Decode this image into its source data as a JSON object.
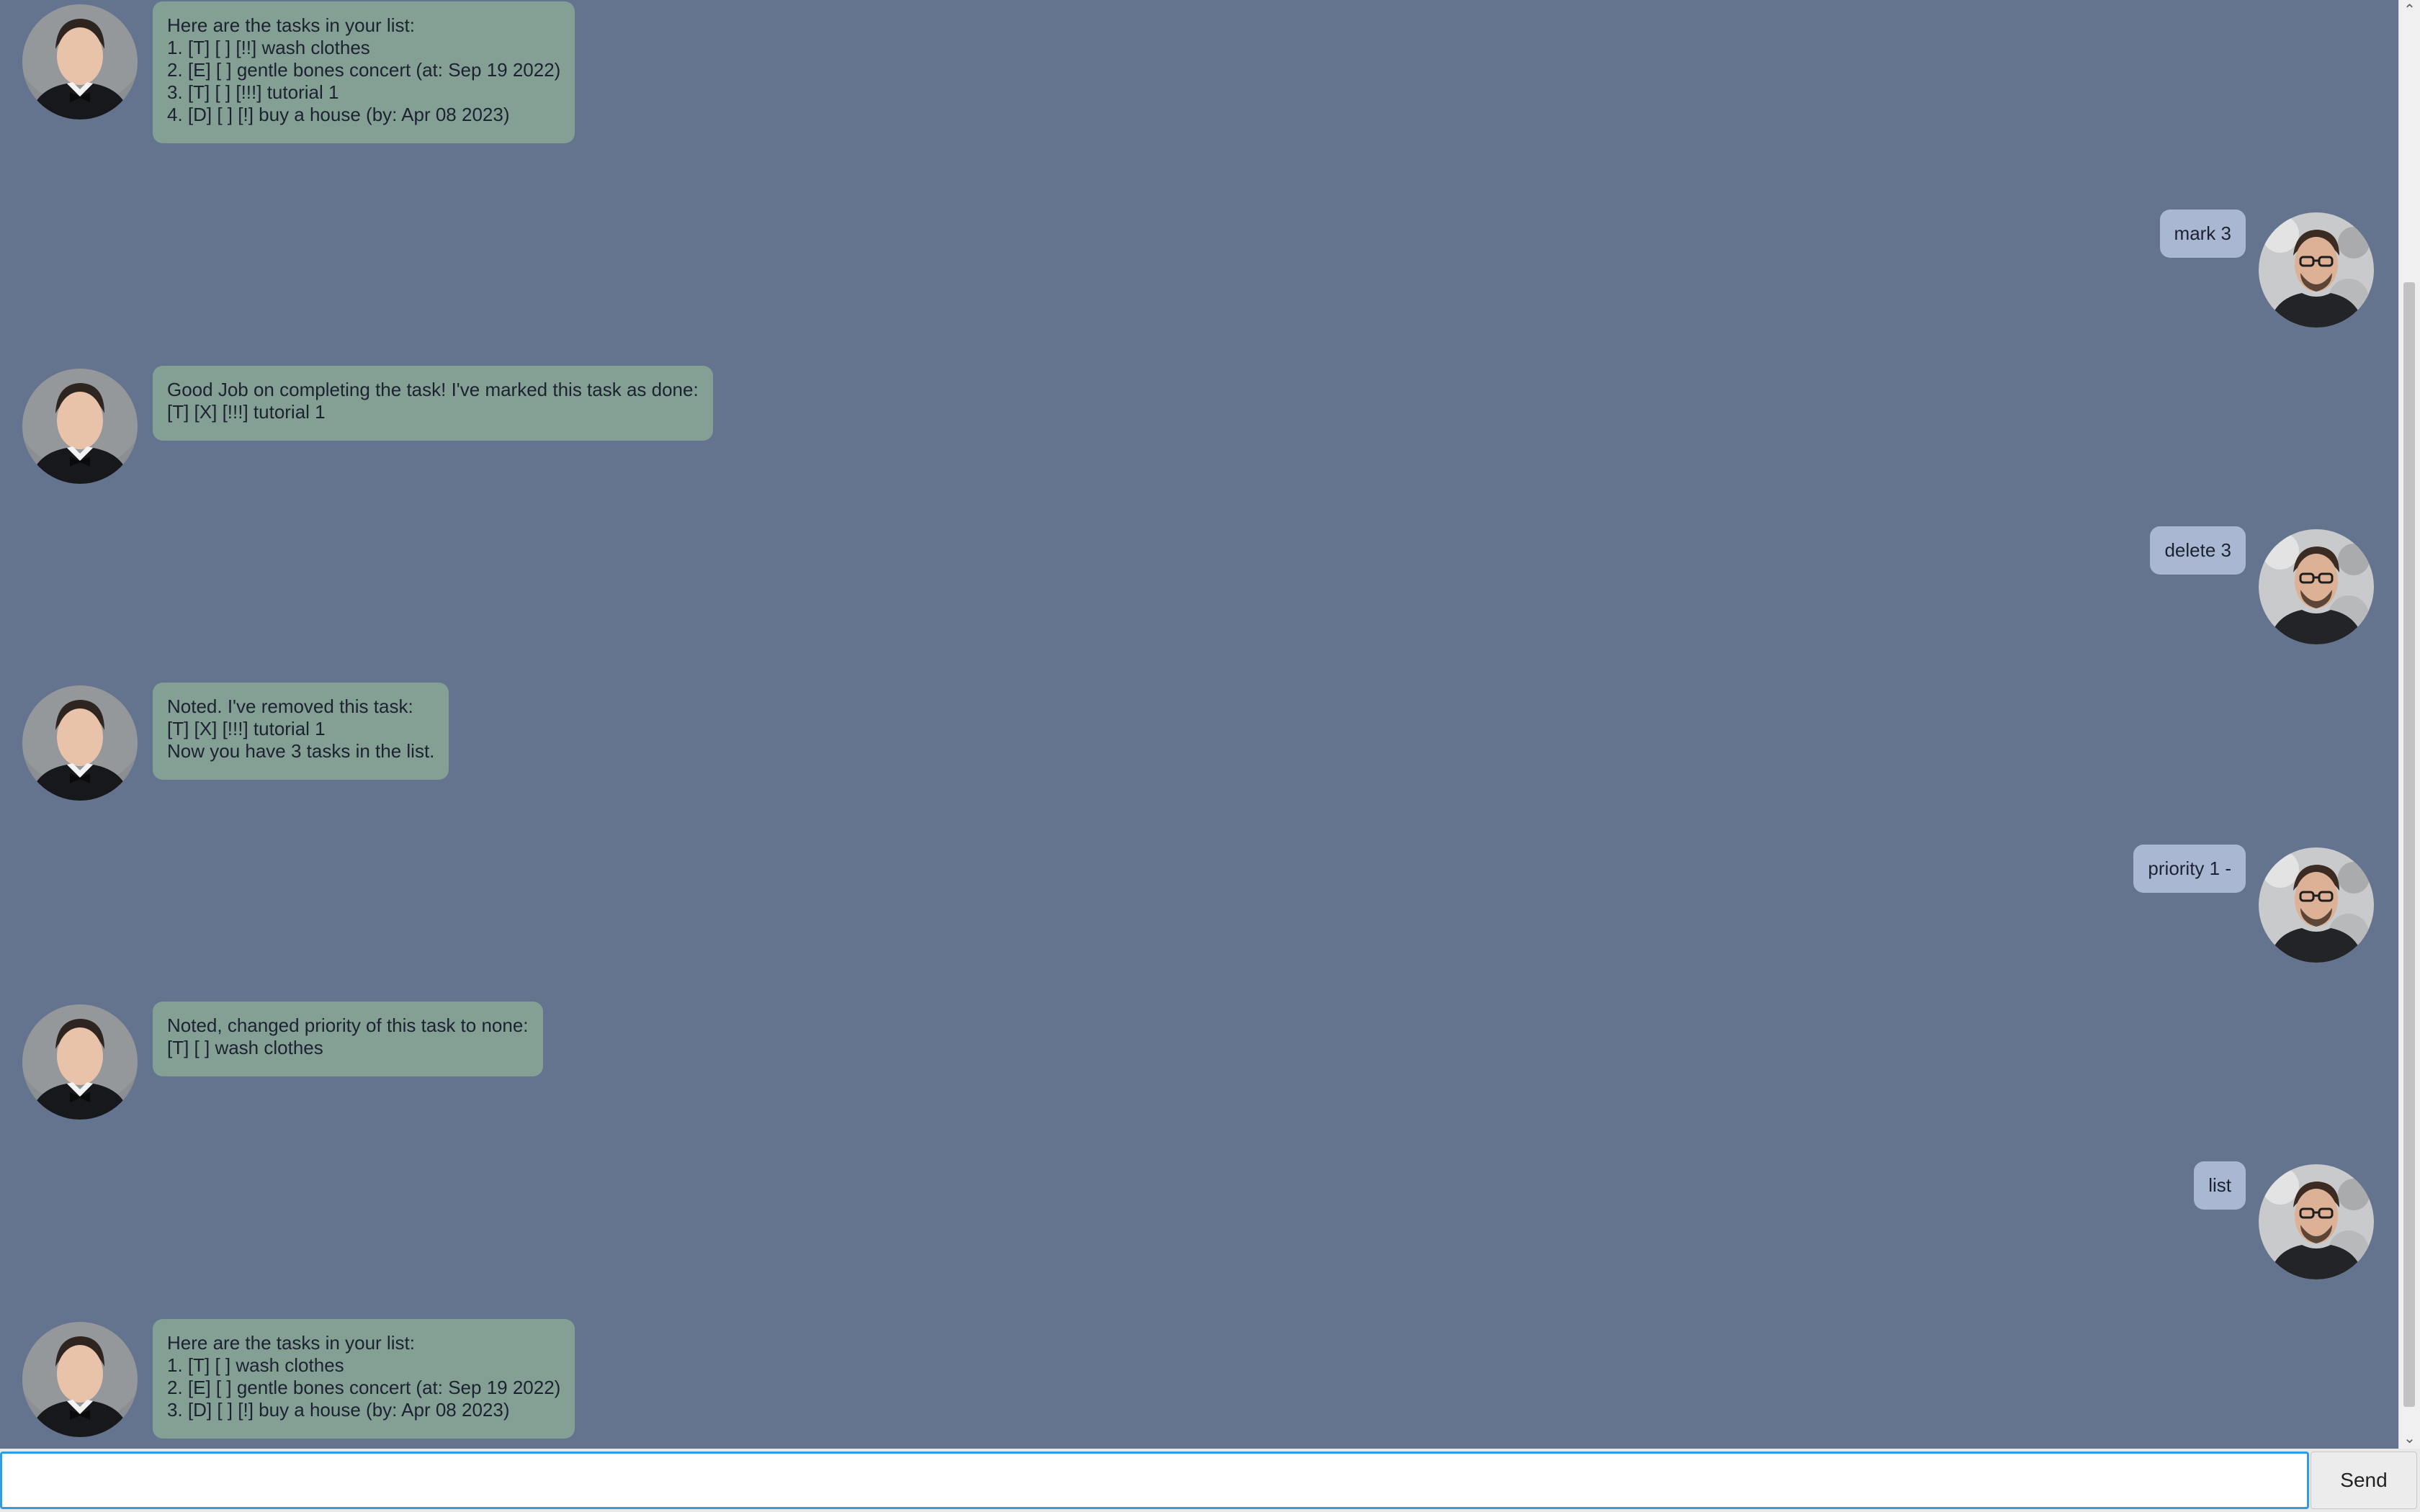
{
  "dialog": {
    "messages": [
      {
        "sender": "bot",
        "text": "Here are the tasks in your list:\n1. [T] [ ] [!!] wash clothes\n2. [E] [ ] gentle bones concert (at: Sep 19 2022)\n3. [T] [ ] [!!!] tutorial 1\n4. [D] [ ] [!] buy a house (by: Apr 08 2023)"
      },
      {
        "sender": "user",
        "text": "mark 3"
      },
      {
        "sender": "bot",
        "text": "Good Job on completing the task! I've marked this task as done:\n[T] [X] [!!!] tutorial 1"
      },
      {
        "sender": "user",
        "text": "delete 3"
      },
      {
        "sender": "bot",
        "text": "Noted. I've removed this task:\n[T] [X] [!!!] tutorial 1\nNow you have 3 tasks in the list."
      },
      {
        "sender": "user",
        "text": "priority 1 -"
      },
      {
        "sender": "bot",
        "text": "Noted, changed priority of this task to none:\n[T] [ ] wash clothes"
      },
      {
        "sender": "user",
        "text": "list"
      },
      {
        "sender": "bot",
        "text": "Here are the tasks in your list:\n1. [T] [ ] wash clothes\n2. [E] [ ] gentle bones concert (at: Sep 19 2022)\n3. [D] [ ] [!] buy a house (by: Apr 08 2023)"
      }
    ]
  },
  "input": {
    "value": "",
    "placeholder": ""
  },
  "send_button": {
    "label": "Send"
  },
  "colors": {
    "background": "#64738e",
    "bot_bubble": "#84a095",
    "user_bubble": "#a9b7d2",
    "input_focus_border": "#2f9be0"
  },
  "icons": {
    "bot_avatar": "bot-avatar",
    "user_avatar": "user-avatar",
    "scroll_up": "chevron-up-icon",
    "scroll_down": "chevron-down-icon"
  }
}
